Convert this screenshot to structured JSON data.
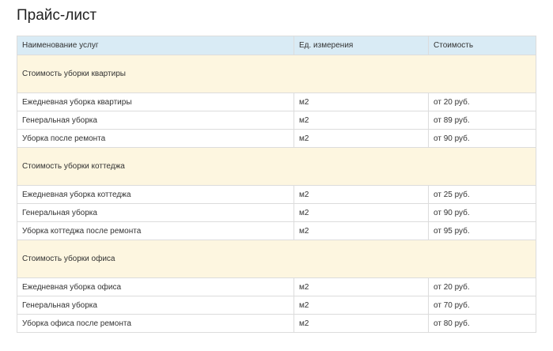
{
  "page": {
    "title": "Прайс-лист"
  },
  "table": {
    "headers": {
      "name": "Наименование услуг",
      "unit": "Ед. измерения",
      "price": "Стоимость"
    },
    "sections": [
      {
        "title": "Стоимость уборки квартиры",
        "rows": [
          {
            "name": "Ежедневная уборка квартиры",
            "unit": "м2",
            "price": "от 20 руб."
          },
          {
            "name": "Генеральная уборка",
            "unit": "м2",
            "price": "от 89 руб."
          },
          {
            "name": "Уборка после ремонта",
            "unit": "м2",
            "price": "от 90 руб."
          }
        ]
      },
      {
        "title": "Стоимость уборки коттеджа",
        "rows": [
          {
            "name": "Ежедневная уборка коттеджа",
            "unit": "м2",
            "price": "от 25 руб."
          },
          {
            "name": "Генеральная уборка",
            "unit": "м2",
            "price": "от 90 руб."
          },
          {
            "name": "Уборка коттеджа после ремонта",
            "unit": "м2",
            "price": "от 95 руб."
          }
        ]
      },
      {
        "title": "Стоимость уборки офиса",
        "rows": [
          {
            "name": "Ежедневная уборка офиса",
            "unit": "м2",
            "price": "от 20 руб."
          },
          {
            "name": "Генеральная уборка",
            "unit": "м2",
            "price": "от 70 руб."
          },
          {
            "name": "Уборка офиса после ремонта",
            "unit": "м2",
            "price": "от 80 руб."
          }
        ]
      }
    ]
  },
  "colors": {
    "header_bg": "#d9ebf5",
    "section_bg": "#fdf6e0",
    "border": "#dcdcdc"
  }
}
